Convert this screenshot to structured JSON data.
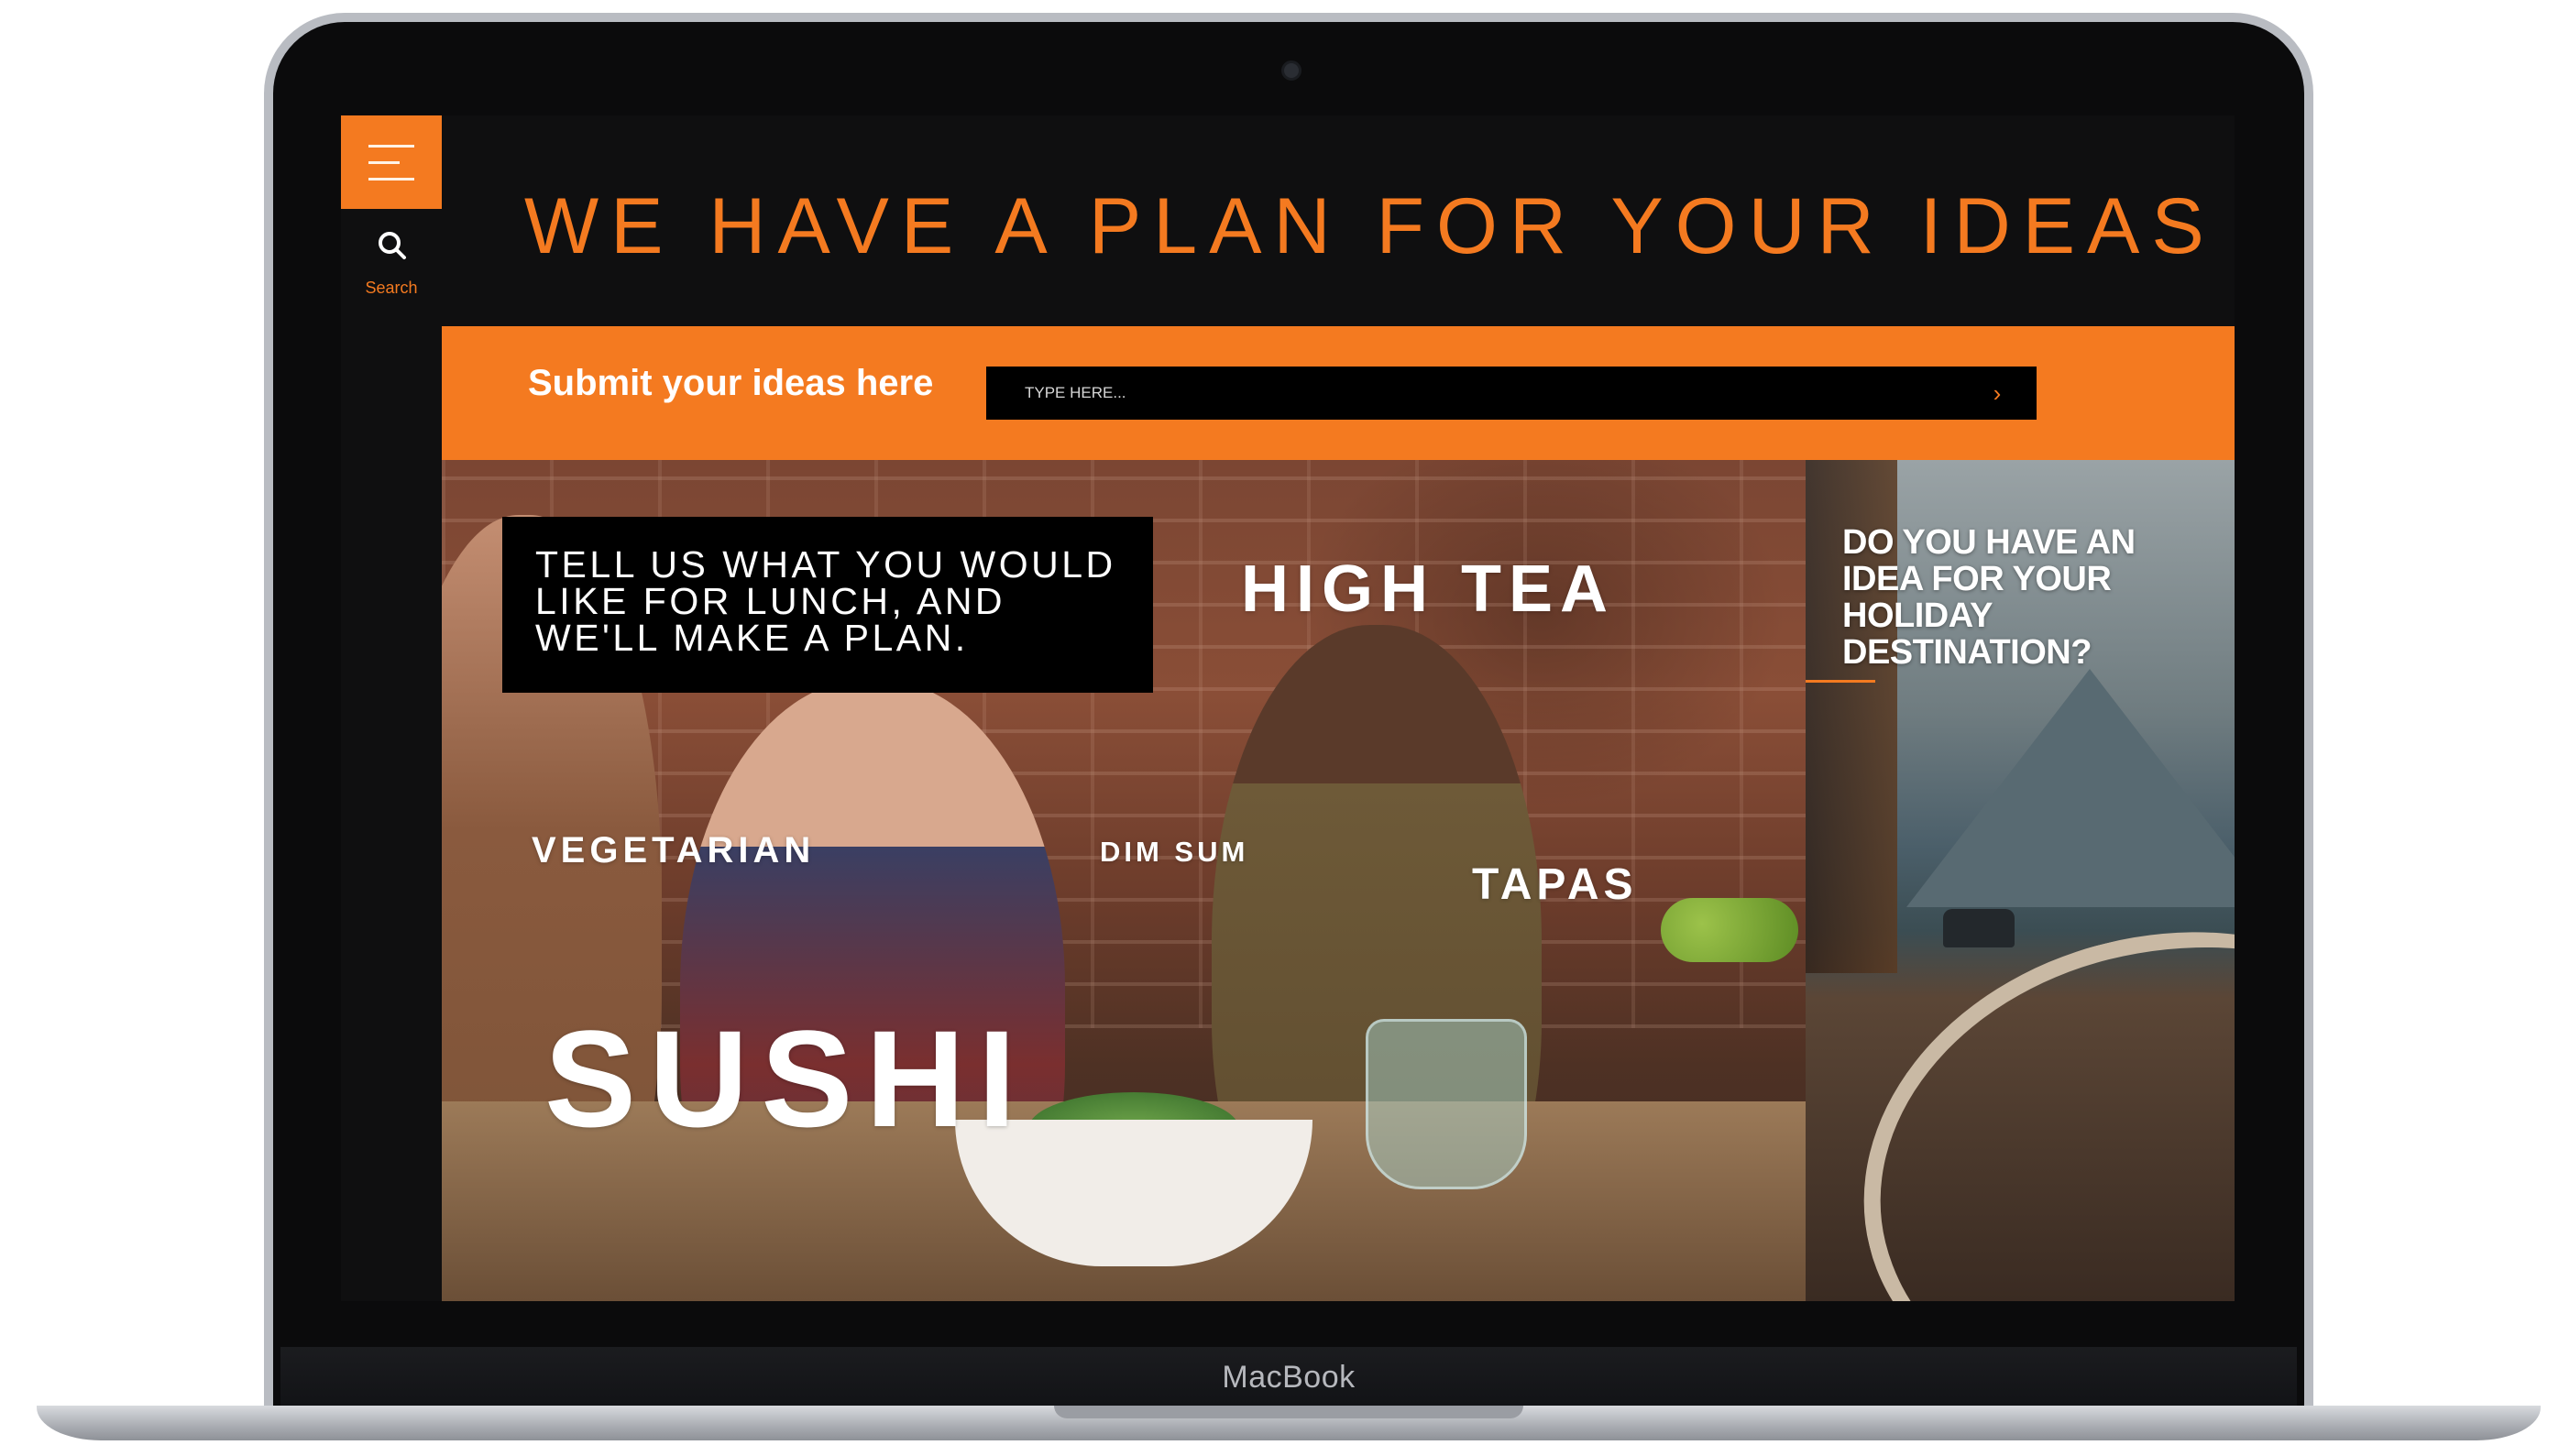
{
  "device": {
    "brand_label": "MacBook"
  },
  "sidebar": {
    "search_label": "Search"
  },
  "header": {
    "headline": "WE HAVE A PLAN FOR YOUR IDEAS"
  },
  "submit": {
    "label": "Submit your ideas here",
    "input_value": "",
    "input_placeholder": "TYPE HERE...",
    "arrow_glyph": "›"
  },
  "food": {
    "prompt": "TELL US WHAT YOU WOULD LIKE FOR LUNCH, AND WE'LL MAKE A PLAN.",
    "tags": {
      "high_tea": "HIGH TEA",
      "vegetarian": "VEGETARIAN",
      "dim_sum": "DIM SUM",
      "tapas": "TAPAS",
      "sushi": "SUSHI"
    }
  },
  "travel": {
    "title": "DO YOU HAVE AN IDEA FOR YOUR HOLIDAY DESTINATION?"
  },
  "colors": {
    "accent": "#f47a20",
    "screen_bg": "#0f0f10",
    "prompt_bg": "#000000"
  },
  "icons": {
    "menu": "hamburger-icon",
    "search": "search-icon",
    "submit": "chevron-right-icon"
  }
}
